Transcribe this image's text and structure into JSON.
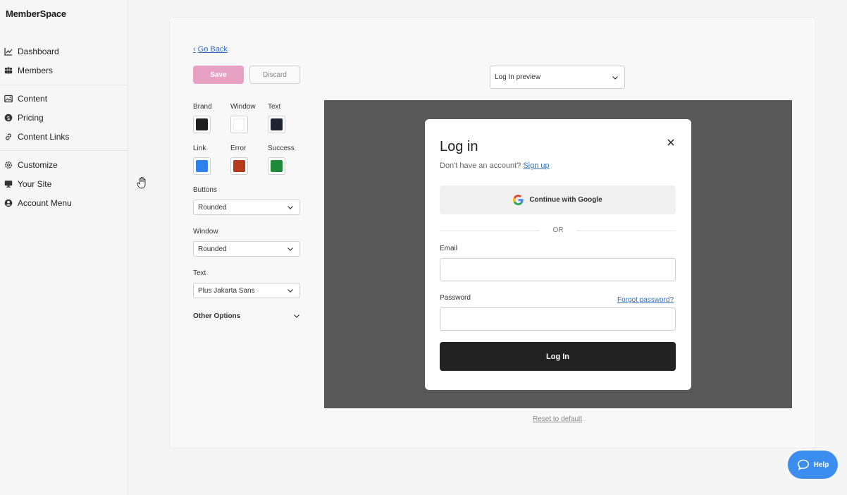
{
  "app": {
    "logo": "MemberSpace"
  },
  "sidebar": {
    "items": [
      {
        "label": "Dashboard",
        "icon": "chart-line-icon"
      },
      {
        "label": "Members",
        "icon": "users-icon"
      },
      {
        "label": "Content",
        "icon": "image-icon"
      },
      {
        "label": "Pricing",
        "icon": "dollar-icon"
      },
      {
        "label": "Content Links",
        "icon": "link-icon"
      },
      {
        "label": "Customize",
        "icon": "gear-icon"
      },
      {
        "label": "Your Site",
        "icon": "monitor-icon"
      },
      {
        "label": "Account Menu",
        "icon": "account-icon"
      }
    ]
  },
  "editor": {
    "go_back": "Go Back",
    "save_label": "Save",
    "discard_label": "Discard",
    "colors": [
      {
        "label": "Brand",
        "value": "#1f1f1f"
      },
      {
        "label": "Window",
        "value": "#ffffff"
      },
      {
        "label": "Text",
        "value": "#1c2333"
      },
      {
        "label": "Link",
        "value": "#2f80ed"
      },
      {
        "label": "Error",
        "value": "#b83a1c"
      },
      {
        "label": "Success",
        "value": "#1e8b3a"
      }
    ],
    "buttons": {
      "label": "Buttons",
      "value": "Rounded"
    },
    "window": {
      "label": "Window",
      "value": "Rounded"
    },
    "text": {
      "label": "Text",
      "value": "Plus Jakarta Sans"
    },
    "other_options": "Other Options"
  },
  "preview": {
    "select_value": "Log In preview",
    "reset": "Reset to default",
    "modal": {
      "title": "Log in",
      "subtitle": "Don't have an account?",
      "signup": "Sign up",
      "google": "Continue with Google",
      "or": "OR",
      "email_label": "Email",
      "password_label": "Password",
      "forgot": "Forgot password?",
      "login": "Log In"
    }
  },
  "help": {
    "label": "Help"
  },
  "colors": {
    "accent_save": "#e7a1c3",
    "help": "#3b8ef0",
    "preview_bg": "#585858"
  }
}
